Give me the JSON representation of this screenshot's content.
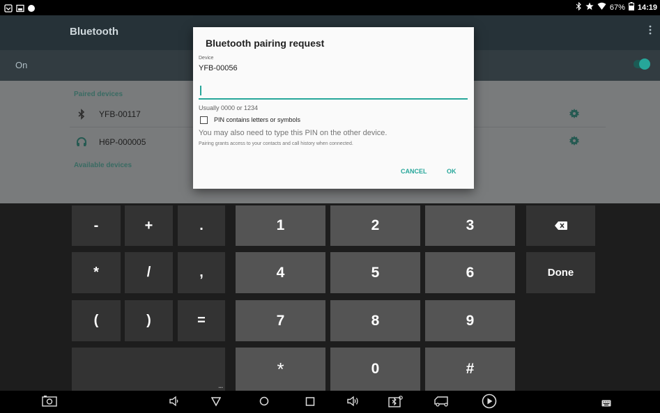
{
  "status_bar": {
    "battery_percent": "67%",
    "time": "14:19",
    "icons": [
      "notification-icon",
      "image-icon",
      "dot-icon",
      "bluetooth-icon",
      "star-icon",
      "wifi-icon",
      "battery-icon"
    ]
  },
  "appbar": {
    "title": "Bluetooth",
    "overflow_icon": "more-vert-icon"
  },
  "bluetooth_toggle": {
    "label": "On",
    "state": "on"
  },
  "paired_devices": {
    "title": "Paired devices",
    "items": [
      {
        "name": "YFB-00117",
        "icon": "bluetooth-icon"
      },
      {
        "name": "H6P-000005",
        "icon": "headphones-icon"
      }
    ]
  },
  "available_devices": {
    "title": "Available devices"
  },
  "dialog": {
    "title": "Bluetooth pairing request",
    "device_label": "Device",
    "device_name": "YFB-00056",
    "pin_value": "",
    "hint": "Usually 0000 or 1234",
    "checkbox_label": "PIN contains letters or symbols",
    "checkbox_checked": false,
    "info": "You may also need to type this PIN on the other device.",
    "sub_info": "Pairing grants access to your contacts and call history when connected.",
    "cancel_label": "CANCEL",
    "ok_label": "OK"
  },
  "keyboard": {
    "symbol_keys": [
      "-",
      "+",
      ".",
      "*",
      "/",
      ",",
      "(",
      ")",
      "="
    ],
    "digit_keys": [
      "1",
      "2",
      "3",
      "4",
      "5",
      "6",
      "7",
      "8",
      "9",
      "*",
      "0",
      "#"
    ],
    "done_label": "Done",
    "more_label": "...",
    "backspace_icon": "backspace-icon"
  },
  "colors": {
    "accent": "#26a69a",
    "appbar": "#263238",
    "dialog_bg": "#fafafa"
  }
}
